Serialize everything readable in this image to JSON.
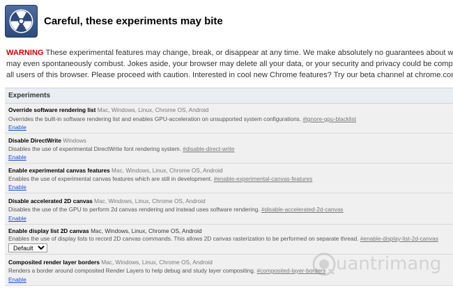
{
  "header": {
    "title": "Careful, these experiments may bite"
  },
  "warning": {
    "label": "WARNING",
    "line1_rest": " These experimental features may change, break, or disappear at any time. We make absolutely no guarantees about what may",
    "line2": "may even spontaneously combust. Jokes aside, your browser may delete all your data, or your security and privacy could be compromised",
    "line3": "all users of this browser. Please proceed with caution. Interested in cool new Chrome features? Try our beta channel at chrome.com/beta."
  },
  "experiments": {
    "header": "Experiments",
    "items": [
      {
        "name": "Override software rendering list",
        "platforms": "Mac, Windows, Linux, Chrome OS, Android",
        "description": "Overrides the built-in software rendering list and enables GPU-acceleration on unsupported system configurations.",
        "flag": "#ignore-gpu-blacklist",
        "action": "Enable"
      },
      {
        "name": "Disable DirectWrite",
        "platforms": "Windows",
        "description": "Disables the use of experimental DirectWrite font rendering system.",
        "flag": "#disable-direct-write",
        "action": "Enable"
      },
      {
        "name": "Enable experimental canvas features",
        "platforms": "Mac, Windows, Linux, Chrome OS, Android",
        "description": "Enables the use of experimental canvas features which are still in development.",
        "flag": "#enable-experimental-canvas-features",
        "action": "Enable"
      },
      {
        "name": "Disable accelerated 2D canvas",
        "platforms": "Mac, Windows, Linux, Chrome OS, Android",
        "description": "Disables the use of the GPU to perform 2d canvas rendering and instead uses software rendering.",
        "flag": "#disable-accelerated-2d-canvas",
        "action": "Enable"
      },
      {
        "name": "Enable display list 2D canvas",
        "platforms": "Mac, Windows, Linux, Chrome OS, Android",
        "description": "Enables the use of display lists to record 2D canvas commands. This allows 2D canvas rasterization to be performed on separate thread.",
        "flag": "#enable-display-list-2d-canvas",
        "select_value": "Default"
      },
      {
        "name": "Composited render layer borders",
        "platforms": "Mac, Windows, Linux, Chrome OS, Android",
        "description": "Renders a border around composited Render Layers to help debug and study layer compositing.",
        "flag": "#composited-layer-borders",
        "action": "Enable"
      }
    ]
  },
  "watermark": {
    "text": "uantrimang"
  },
  "colors": {
    "warning": "#cc0000",
    "link": "#1a4fd6",
    "panel_header_bg": "#eaeef4",
    "row_bg": "#f0f0f0"
  },
  "icons": {
    "logo": "radiation-icon",
    "watermark": "quantrimang-logo-icon"
  }
}
